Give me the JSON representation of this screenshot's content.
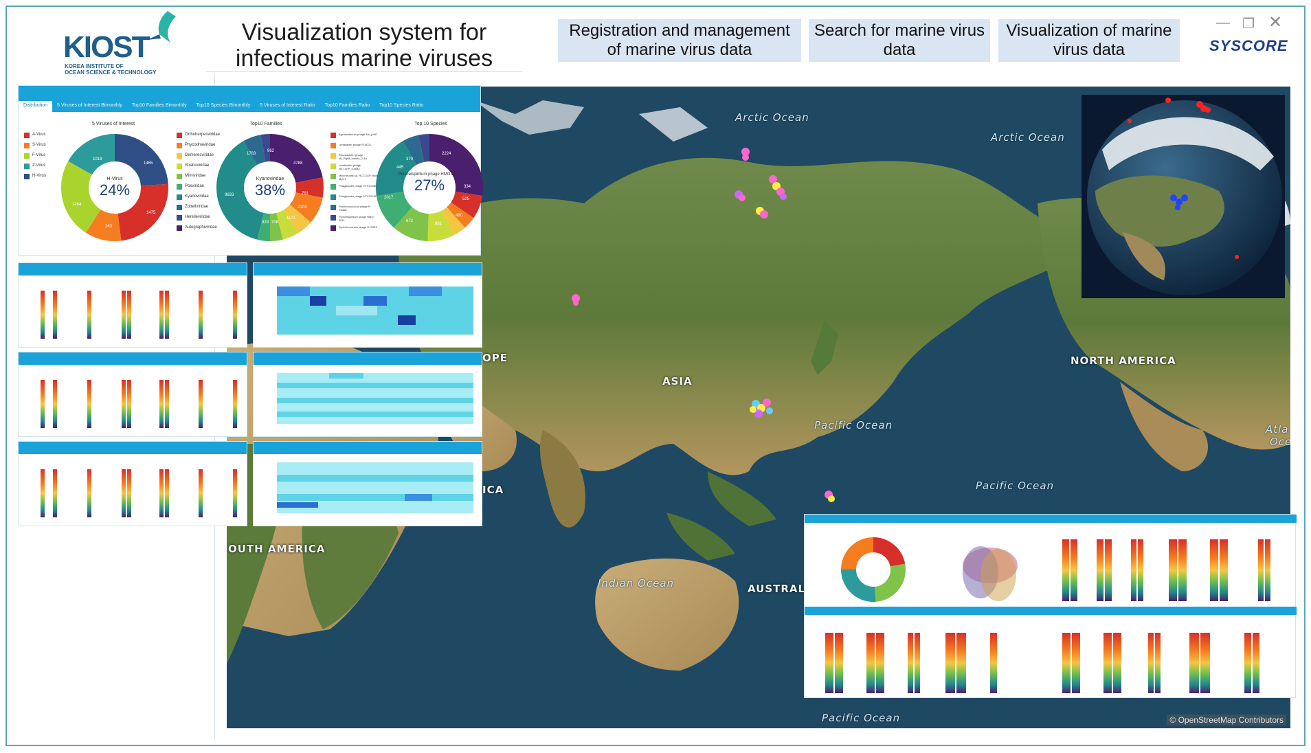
{
  "header": {
    "logo_text": "KIOST",
    "logo_sub1": "KOREA INSTITUTE OF",
    "logo_sub2": "OCEAN SCIENCE & TECHNOLOGY",
    "title_line1": "Visualization system for",
    "title_line2": "infectious marine viruses",
    "nav": [
      {
        "line1": "Registration and management",
        "line2": "of marine virus data"
      },
      {
        "line1": "Search for marine virus",
        "line2": "data"
      },
      {
        "line1": "Visualization of marine",
        "line2": "virus data"
      }
    ],
    "brand": "SYSCORE",
    "window_controls": {
      "minimize": "—",
      "maximize": "❐",
      "close": "✕"
    }
  },
  "map": {
    "oceans": [
      {
        "text": "Arctic Ocean"
      },
      {
        "text": "Arctic Ocean"
      },
      {
        "text": "Pacific Ocean"
      },
      {
        "text": "Pacific Ocean"
      },
      {
        "text": "Indian Ocean"
      },
      {
        "text": "Pacific Ocean"
      },
      {
        "text": "Atla"
      },
      {
        "text": "Oce"
      }
    ],
    "continents": [
      {
        "text": "ASIA"
      },
      {
        "text": "NORTH AMERICA"
      },
      {
        "text": "OPE"
      },
      {
        "text": "ICA"
      },
      {
        "text": "OUTH AMERICA"
      },
      {
        "text": "AUSTRAL"
      }
    ],
    "attribution": "© OpenStreetMap Contributors",
    "marker_colors": [
      "#ff66cc",
      "#cc66ff",
      "#ffee44",
      "#66ccff",
      "#3366ff"
    ]
  },
  "dashboard": {
    "tabs": [
      "Distribution",
      "5 Viruses of Interest Bimonthly",
      "Top10 Families Bimonthly",
      "Top10 Species Bimonthly",
      "5 Viruses of Interest Ratio",
      "Top10 Families Ratio",
      "Top10 Species Ratio"
    ],
    "pie1": {
      "title": "5 Viruses of Interest",
      "center_name": "H-Virus",
      "center_pct": "24%",
      "legend": [
        "A-Virus",
        "S-Virus",
        "F-Virus",
        "Z-Virus",
        "H-Virus"
      ],
      "slice_labels": [
        "1018",
        "1465",
        "1475",
        "263",
        "1464"
      ]
    },
    "pie2": {
      "title": "Top10 Families",
      "center_name": "Kyanoviridae",
      "center_pct": "38%",
      "legend": [
        "Orthoherpesviridae",
        "Phycodnaviridae",
        "Demerecviridae",
        "Straboviridae",
        "Mimiviridae",
        "Poxviridae",
        "Kyanoviridae",
        "Zobellviridae",
        "Herelleviridae",
        "Autographiviridae"
      ],
      "slice_labels": [
        "1783",
        "962",
        "4788",
        "791",
        "2103",
        "1171",
        "929",
        "708",
        "8633"
      ]
    },
    "pie3": {
      "title": "Top 10 Species",
      "center_name": "Puniceispirillum phage HMO-2011",
      "center_pct": "27%",
      "legend": [
        "Agrobacterium phage Atu_ph07",
        "Lentibacter phage P10D2L",
        "Rhodobacter phage vB_RglM_Imbulu_2-4A",
        "Lentibacter phage vB_LenP_ICBM2",
        "Micromonas sp. RCC1109 virus MpV1",
        "Pelagibacter phage HTVC008M",
        "Pelagibacter phage HTVC010P",
        "Prochlorococcus phage P-TIM68",
        "Puniceispirillum phage HMO-2011",
        "Synechococcus phage S-CBS3"
      ],
      "slice_labels": [
        "379",
        "2224",
        "445",
        "334",
        "525",
        "2017",
        "672",
        "861",
        "480"
      ]
    }
  }
}
